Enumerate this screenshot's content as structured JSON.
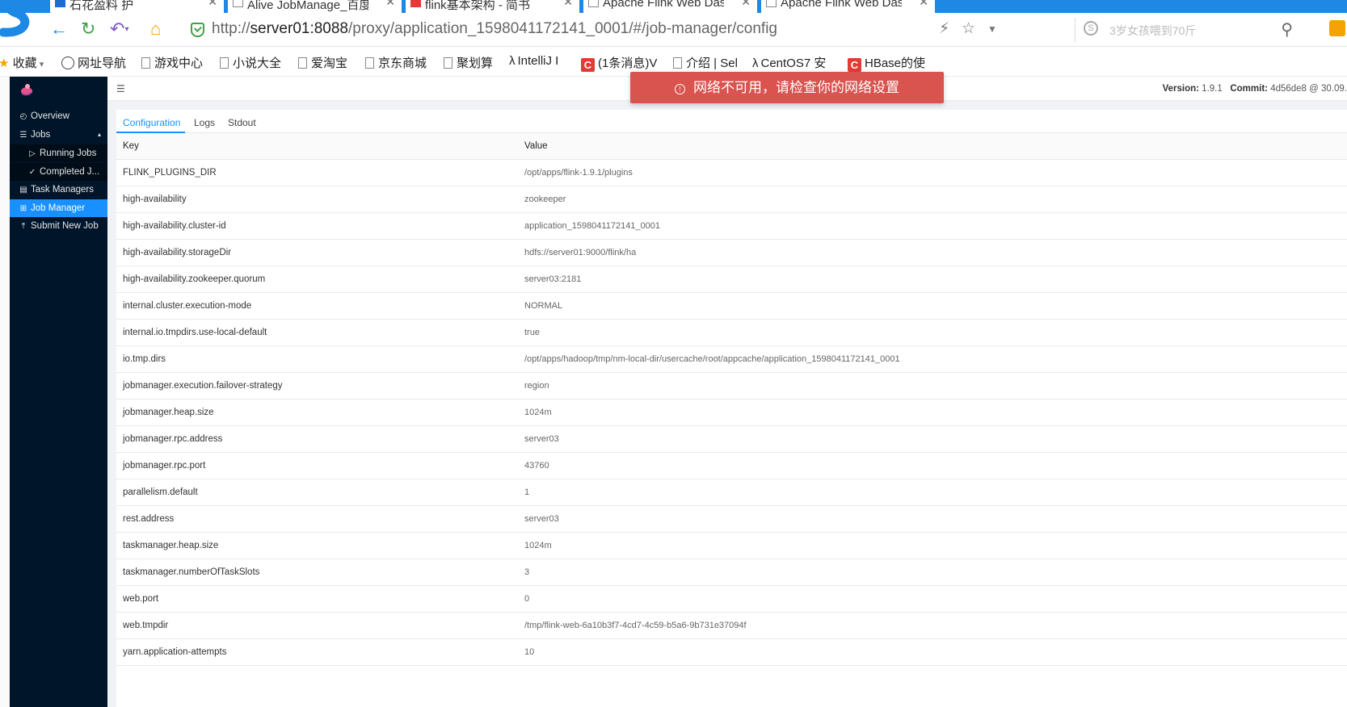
{
  "browser": {
    "tabs": [
      {
        "label": "石花盈料 护",
        "icon": "blue"
      },
      {
        "label": "Alive JobManage_百度",
        "icon": "page"
      },
      {
        "label": "flink基本架构 - 简书",
        "icon": "red"
      },
      {
        "label": "Apache Flink Web Das",
        "icon": "page"
      },
      {
        "label": "Apache Flink Web Das",
        "icon": "page"
      }
    ],
    "url_prefix": "http://",
    "url_host": "server01:8088",
    "url_path": "/proxy/application_1598041172141_0001/#/job-manager/config",
    "search_placeholder": "3岁女孩喂到70斤",
    "bookmarks": [
      {
        "label": "收藏",
        "kind": "star"
      },
      {
        "label": "网址导航",
        "kind": "globe"
      },
      {
        "label": "游戏中心",
        "kind": "page"
      },
      {
        "label": "小说大全",
        "kind": "page"
      },
      {
        "label": "爱淘宝",
        "kind": "page"
      },
      {
        "label": "京东商城",
        "kind": "page"
      },
      {
        "label": "聚划算",
        "kind": "page"
      },
      {
        "label": "IntelliJ I",
        "kind": "claw"
      },
      {
        "label": "(1条消息)V",
        "kind": "csdn"
      },
      {
        "label": "介绍 | Sel",
        "kind": "page"
      },
      {
        "label": "CentOS7 安",
        "kind": "claw"
      },
      {
        "label": "HBase的使",
        "kind": "csdn"
      }
    ]
  },
  "sidebar": {
    "items": [
      {
        "label": "Overview",
        "icon": "dashboard-icon",
        "sub": false,
        "active": false
      },
      {
        "label": "Jobs",
        "icon": "list-icon",
        "sub": false,
        "active": false,
        "expanded": true
      },
      {
        "label": "Running Jobs",
        "icon": "play-circle-icon",
        "sub": true,
        "active": false
      },
      {
        "label": "Completed J...",
        "icon": "check-circle-icon",
        "sub": true,
        "active": false
      },
      {
        "label": "Task Managers",
        "icon": "calendar-icon",
        "sub": false,
        "active": false
      },
      {
        "label": "Job Manager",
        "icon": "cluster-icon",
        "sub": false,
        "active": true
      },
      {
        "label": "Submit New Job",
        "icon": "upload-icon",
        "sub": false,
        "active": false
      }
    ]
  },
  "header": {
    "version_label": "Version:",
    "version_value": "1.9.1",
    "commit_label": "Commit:",
    "commit_value": "4d56de8 @ 30.09."
  },
  "toast": {
    "message": "网络不可用，请检查你的网络设置"
  },
  "tabs": [
    {
      "label": "Configuration",
      "active": true
    },
    {
      "label": "Logs",
      "active": false
    },
    {
      "label": "Stdout",
      "active": false
    }
  ],
  "table": {
    "columns": [
      "Key",
      "Value"
    ],
    "rows": [
      [
        "FLINK_PLUGINS_DIR",
        "/opt/apps/flink-1.9.1/plugins"
      ],
      [
        "high-availability",
        "zookeeper"
      ],
      [
        "high-availability.cluster-id",
        "application_1598041172141_0001"
      ],
      [
        "high-availability.storageDir",
        "hdfs://server01:9000/flink/ha"
      ],
      [
        "high-availability.zookeeper.quorum",
        "server03:2181"
      ],
      [
        "internal.cluster.execution-mode",
        "NORMAL"
      ],
      [
        "internal.io.tmpdirs.use-local-default",
        "true"
      ],
      [
        "io.tmp.dirs",
        "/opt/apps/hadoop/tmp/nm-local-dir/usercache/root/appcache/application_1598041172141_0001"
      ],
      [
        "jobmanager.execution.failover-strategy",
        "region"
      ],
      [
        "jobmanager.heap.size",
        "1024m"
      ],
      [
        "jobmanager.rpc.address",
        "server03"
      ],
      [
        "jobmanager.rpc.port",
        "43760"
      ],
      [
        "parallelism.default",
        "1"
      ],
      [
        "rest.address",
        "server03"
      ],
      [
        "taskmanager.heap.size",
        "1024m"
      ],
      [
        "taskmanager.numberOfTaskSlots",
        "3"
      ],
      [
        "web.port",
        "0"
      ],
      [
        "web.tmpdir",
        "/tmp/flink-web-6a10b3f7-4cd7-4c59-b5a6-9b731e37094f"
      ],
      [
        "yarn.application-attempts",
        "10"
      ]
    ]
  }
}
